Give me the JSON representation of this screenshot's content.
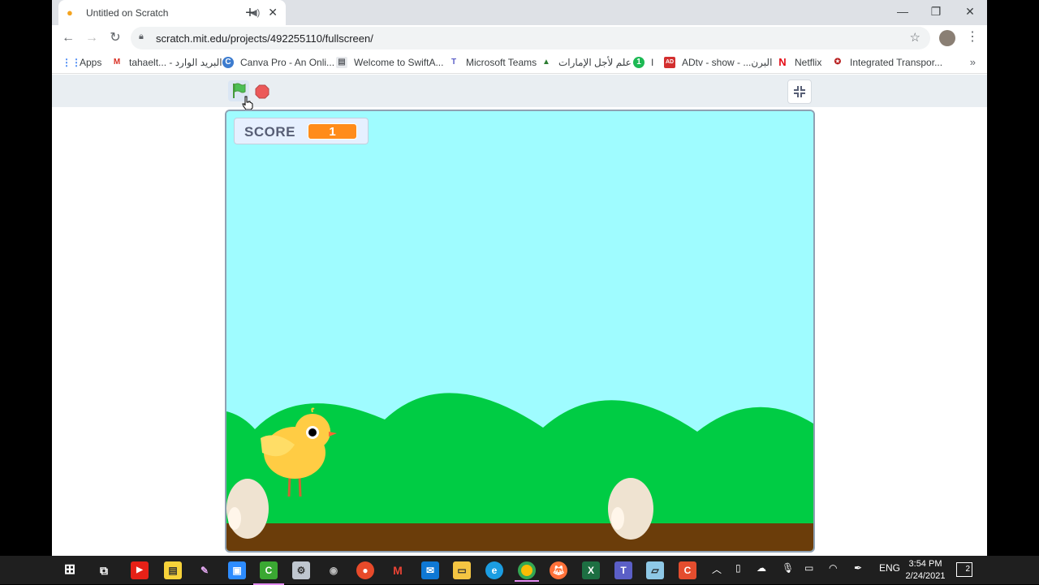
{
  "tab": {
    "title": "Untitled on Scratch",
    "favicon": "scratch-cat-icon"
  },
  "toolbar": {
    "url": "scratch.mit.edu/projects/492255110/fullscreen/"
  },
  "bookmarks": [
    {
      "label": "Apps",
      "icon": "apps-grid-icon"
    },
    {
      "label": "tahaelt... - البريد الوارد",
      "icon": "gmail-icon"
    },
    {
      "label": "Canva Pro - An Onli...",
      "icon": "canva-icon"
    },
    {
      "label": "Welcome to SwiftA...",
      "icon": "doc-icon"
    },
    {
      "label": "Microsoft Teams",
      "icon": "teams-icon"
    },
    {
      "label": "علم لأجل الإمارات",
      "icon": "uae-icon"
    },
    {
      "label": "I",
      "icon": "number-one-icon"
    },
    {
      "label": "ADtv - show - ...البرن",
      "icon": "adtv-icon"
    },
    {
      "label": "Netflix",
      "icon": "netflix-icon"
    },
    {
      "label": "Integrated Transpor...",
      "icon": "itc-icon"
    }
  ],
  "scratch": {
    "score_label": "SCORE",
    "score_value": "1"
  },
  "taskbar": {
    "language": "ENG",
    "time": "3:54 PM",
    "date": "2/24/2021",
    "notifications": "2"
  },
  "colors": {
    "sky": "#9ffcff",
    "hills": "#00cc44",
    "ground": "#6b3d0a",
    "score_orange": "#ff8c1a"
  }
}
